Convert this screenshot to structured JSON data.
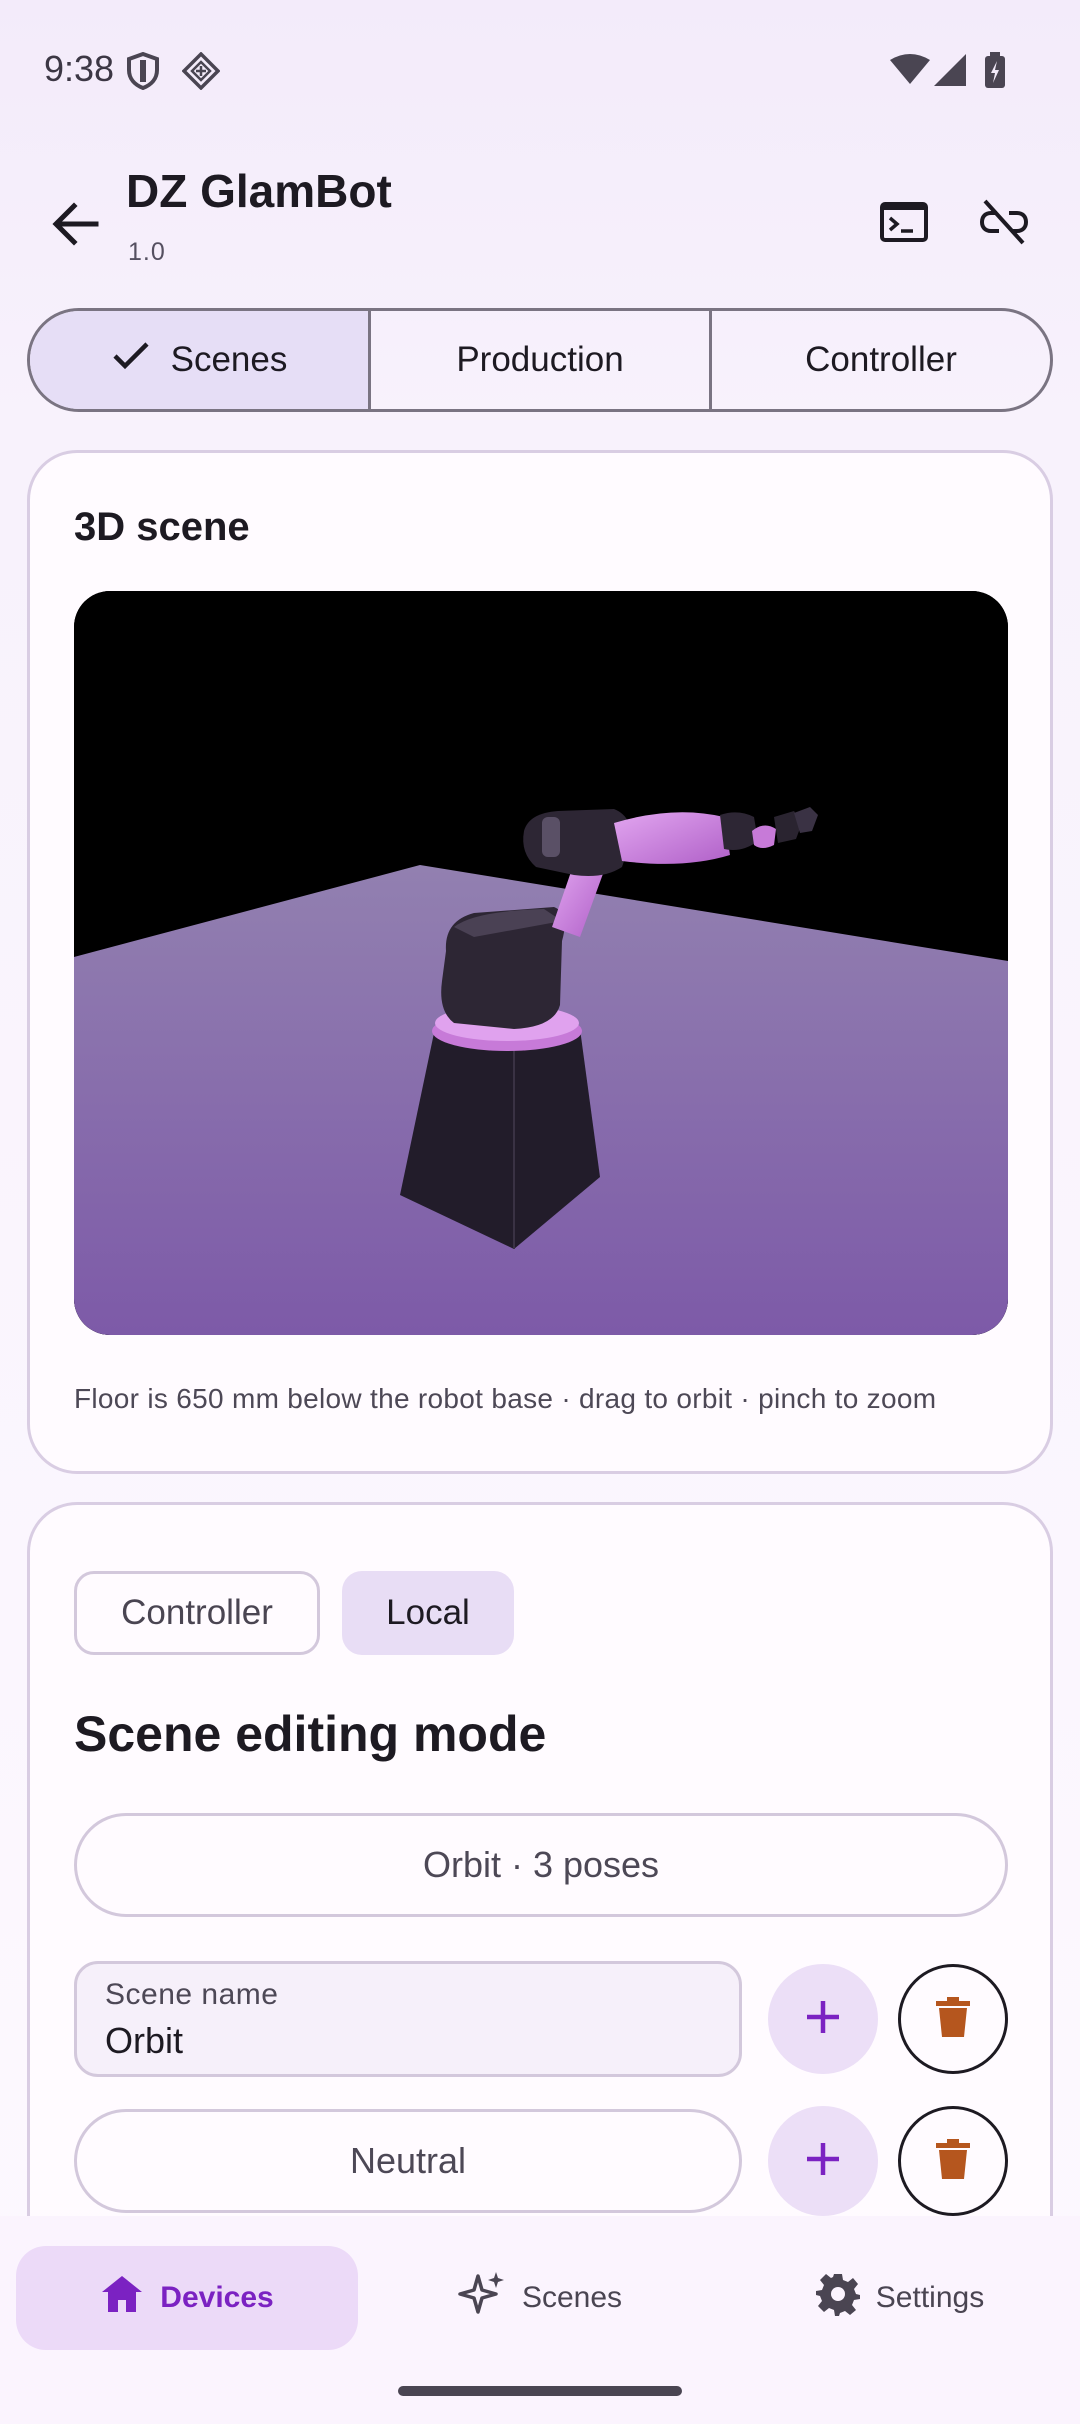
{
  "status_bar": {
    "time": "9:38"
  },
  "app_bar": {
    "title": "DZ GlamBot",
    "subtitle": "1.0"
  },
  "tabs": [
    {
      "label": "Scenes",
      "selected": true
    },
    {
      "label": "Production",
      "selected": false
    },
    {
      "label": "Controller",
      "selected": false
    }
  ],
  "scene_card": {
    "title": "3D scene",
    "caption": "Floor is 650 mm below the robot base · drag to orbit · pinch to zoom"
  },
  "editing_card": {
    "source_chips": [
      {
        "label": "Controller",
        "selected": false
      },
      {
        "label": "Local",
        "selected": true
      }
    ],
    "title": "Scene editing mode",
    "scene_selector": "Orbit · 3 poses",
    "scene_name_field": {
      "label": "Scene name",
      "value": "Orbit"
    },
    "pose_button": "Neutral"
  },
  "bottom_nav": {
    "items": [
      {
        "label": "Devices",
        "icon": "home-icon",
        "selected": true
      },
      {
        "label": "Scenes",
        "icon": "sparkle-icon",
        "selected": false
      },
      {
        "label": "Settings",
        "icon": "gear-icon",
        "selected": false
      }
    ]
  },
  "colors": {
    "accent": "#7b22c2",
    "delete": "#b5561e",
    "floor": "#8a6cb4"
  }
}
